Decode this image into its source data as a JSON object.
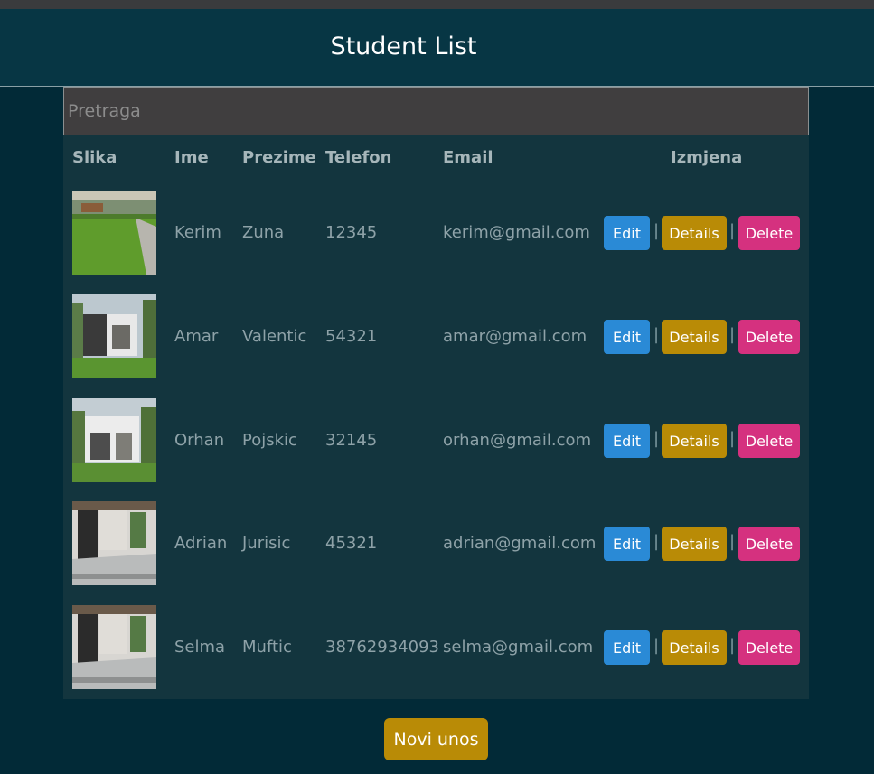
{
  "header": {
    "title": "Student List"
  },
  "search": {
    "placeholder": "Pretraga"
  },
  "table": {
    "columns": [
      "Slika",
      "Ime",
      "Prezime",
      "Telefon",
      "Email",
      "Izmjena"
    ],
    "rows": [
      {
        "ime": "Kerim",
        "prezime": "Zuna",
        "telefon": "12345",
        "email": "kerim@gmail.com",
        "image": "lawn-garden"
      },
      {
        "ime": "Amar",
        "prezime": "Valentic",
        "telefon": "54321",
        "email": "amar@gmail.com",
        "image": "modern-house"
      },
      {
        "ime": "Orhan",
        "prezime": "Pojskic",
        "telefon": "32145",
        "email": "orhan@gmail.com",
        "image": "modern-house"
      },
      {
        "ime": "Adrian",
        "prezime": "Jurisic",
        "telefon": "45321",
        "email": "adrian@gmail.com",
        "image": "house-entrance"
      },
      {
        "ime": "Selma",
        "prezime": "Muftic",
        "telefon": "38762934093",
        "email": "selma@gmail.com",
        "image": "house-entrance"
      }
    ],
    "actions": {
      "edit": "Edit",
      "details": "Details",
      "delete": "Delete",
      "separator": "|"
    }
  },
  "new_entry_label": "Novi unos",
  "colors": {
    "edit": "#2a8ad6",
    "details": "#b98b06",
    "delete": "#d5317f",
    "background": "#022a37"
  }
}
